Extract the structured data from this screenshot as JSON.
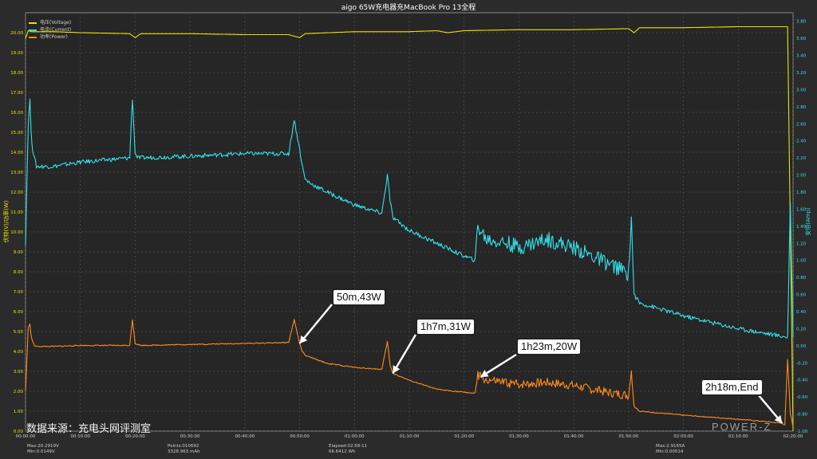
{
  "chart_data": {
    "type": "line",
    "title": "aigo 65W充电器充MacBook Pro 13全程",
    "ylabel_left": "伏特(V)/功率(W)",
    "ylabel_right": "安培(Amp)",
    "ylim_left": [
      0,
      21
    ],
    "ylim_right": [
      -1.0,
      3.9
    ],
    "xlim_minutes": [
      0,
      140
    ],
    "left_ticks": [
      "0.00",
      "1.00",
      "2.00",
      "3.00",
      "4.00",
      "5.00",
      "6.00",
      "7.00",
      "8.00",
      "9.00",
      "10.00",
      "11.00",
      "12.00",
      "13.00",
      "14.00",
      "15.00",
      "16.00",
      "17.00",
      "18.00",
      "19.00",
      "20.00"
    ],
    "right_ticks": [
      "-1.00",
      "-0.80",
      "-0.60",
      "-0.40",
      "-0.20",
      "0.00",
      "0.20",
      "0.40",
      "0.60",
      "0.80",
      "1.00",
      "1.20",
      "1.40",
      "1.60",
      "1.80",
      "2.00",
      "2.20",
      "2.40",
      "2.60",
      "2.80",
      "3.00",
      "3.20",
      "3.40",
      "3.60",
      "3.80"
    ],
    "x_ticks": [
      "00:00:00",
      "00:10:00",
      "00:20:00",
      "00:30:00",
      "00:40:00",
      "00:50:00",
      "01:00:00",
      "01:10:00",
      "01:20:00",
      "01:30:00",
      "01:40:00",
      "01:50:00",
      "02:00:00",
      "02:10:00",
      "02:20:00"
    ],
    "grid": true,
    "legend_position": "top-left",
    "series": [
      {
        "name": "电压(Voltage)",
        "axis": "left",
        "color": "#e6e600",
        "x": [
          0,
          0.5,
          1,
          5,
          10,
          19,
          20,
          21,
          30,
          40,
          48,
          50,
          51,
          60,
          70,
          75,
          77,
          80,
          90,
          100,
          110,
          111,
          112,
          120,
          130,
          139,
          140
        ],
        "values": [
          19.7,
          20.1,
          20.05,
          20.05,
          20.0,
          19.95,
          19.75,
          19.95,
          19.95,
          19.9,
          19.9,
          19.75,
          19.95,
          20.05,
          20.05,
          20.1,
          20.0,
          20.1,
          20.15,
          20.15,
          20.2,
          20.0,
          20.25,
          20.25,
          20.3,
          20.3,
          0.0
        ]
      },
      {
        "name": "电流(Current)",
        "axis": "right",
        "color": "#35e0e8",
        "x": [
          0,
          0.5,
          0.8,
          1,
          1.3,
          1.6,
          2,
          5,
          10,
          19,
          19.5,
          20,
          20.5,
          21,
          30,
          40,
          48,
          49,
          50,
          50.5,
          51,
          52,
          55,
          60,
          65,
          66,
          66.5,
          67,
          70,
          75,
          80,
          82,
          82.5,
          84,
          88,
          90,
          95,
          100,
          105,
          110,
          110.5,
          111,
          112,
          120,
          130,
          139,
          139.5,
          140
        ],
        "values": [
          1.2,
          2.6,
          2.9,
          2.5,
          2.3,
          2.2,
          2.1,
          2.1,
          2.15,
          2.2,
          2.9,
          2.25,
          2.2,
          2.2,
          2.22,
          2.25,
          2.25,
          2.65,
          2.3,
          2.1,
          1.95,
          1.9,
          1.8,
          1.65,
          1.55,
          2.0,
          1.7,
          1.5,
          1.35,
          1.2,
          1.05,
          1.0,
          1.4,
          1.25,
          1.2,
          1.15,
          1.25,
          1.15,
          1.0,
          0.85,
          1.5,
          0.6,
          0.5,
          0.35,
          0.2,
          0.1,
          1.7,
          0.1
        ]
      },
      {
        "name": "功率(Power)",
        "axis": "left",
        "color": "#ff8c1a",
        "x": [
          0,
          0.5,
          0.8,
          1,
          1.3,
          1.6,
          2,
          5,
          10,
          19,
          19.5,
          20,
          20.5,
          21,
          30,
          40,
          48,
          49,
          50,
          50.5,
          51,
          52,
          55,
          60,
          65,
          66,
          66.5,
          67,
          70,
          75,
          80,
          82,
          82.5,
          84,
          88,
          90,
          95,
          100,
          105,
          110,
          110.5,
          111,
          112,
          120,
          130,
          138,
          138.5,
          139,
          139.5,
          140
        ],
        "values": [
          2.0,
          5.2,
          5.4,
          4.8,
          4.5,
          4.3,
          4.25,
          4.25,
          4.3,
          4.3,
          5.6,
          4.4,
          4.35,
          4.3,
          4.35,
          4.4,
          4.45,
          5.6,
          4.4,
          4.0,
          3.8,
          3.7,
          3.4,
          3.2,
          3.1,
          4.5,
          3.3,
          2.9,
          2.55,
          2.1,
          1.95,
          1.9,
          2.8,
          2.55,
          2.4,
          2.35,
          2.45,
          2.3,
          2.0,
          1.8,
          3.1,
          1.25,
          1.0,
          0.8,
          0.6,
          0.4,
          0.3,
          3.6,
          0.9,
          0.2
        ]
      }
    ],
    "annotations": [
      {
        "text": "50m,43W",
        "x": 50
      },
      {
        "text": "1h7m,31W",
        "x": 67
      },
      {
        "text": "1h23m,20W",
        "x": 83
      },
      {
        "text": "2h18m,End",
        "x": 138
      }
    ]
  },
  "watermark": "数据来源：充电头网评测室",
  "brand": "POWER-Z",
  "status": {
    "max_v": "Max:20.2919V",
    "min_v": "Min:0.0149V",
    "points": "Points:010692",
    "mah": "3328.963 mAh",
    "elapsed": "Elapsed:02:58:11",
    "wh": "66.6412 Wh",
    "max_a": "Max:2.9165A",
    "min_a": "Min:0.00014"
  }
}
